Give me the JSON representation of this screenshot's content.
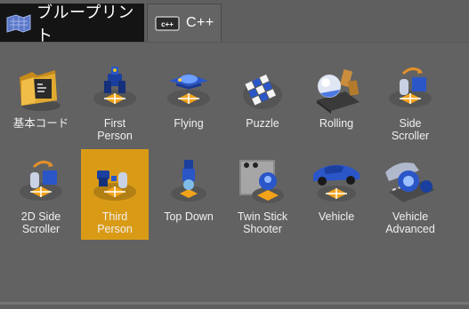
{
  "tabs": [
    {
      "label": "ブループリント",
      "icon": "blueprint-icon"
    },
    {
      "label": "C++",
      "icon": "cpp-icon"
    }
  ],
  "templates": [
    {
      "label": "基本コード",
      "icon": "basic-code-folder-icon"
    },
    {
      "label": "First\nPerson",
      "icon": "first-person-icon"
    },
    {
      "label": "Flying",
      "icon": "flying-ship-icon"
    },
    {
      "label": "Puzzle",
      "icon": "puzzle-blocks-icon"
    },
    {
      "label": "Rolling",
      "icon": "rolling-ball-icon"
    },
    {
      "label": "Side\nScroller",
      "icon": "side-scroller-icon"
    },
    {
      "label": "2D Side\nScroller",
      "icon": "2d-side-scroller-icon"
    },
    {
      "label": "Third\nPerson",
      "icon": "third-person-icon",
      "selected": true
    },
    {
      "label": "Top Down",
      "icon": "top-down-icon"
    },
    {
      "label": "Twin Stick\nShooter",
      "icon": "twin-stick-shooter-icon"
    },
    {
      "label": "Vehicle",
      "icon": "vehicle-icon"
    },
    {
      "label": "Vehicle\nAdvanced",
      "icon": "vehicle-advanced-icon"
    }
  ],
  "colors": {
    "selected": "#d99b16",
    "background": "#626262",
    "active_tab": "#141414"
  }
}
